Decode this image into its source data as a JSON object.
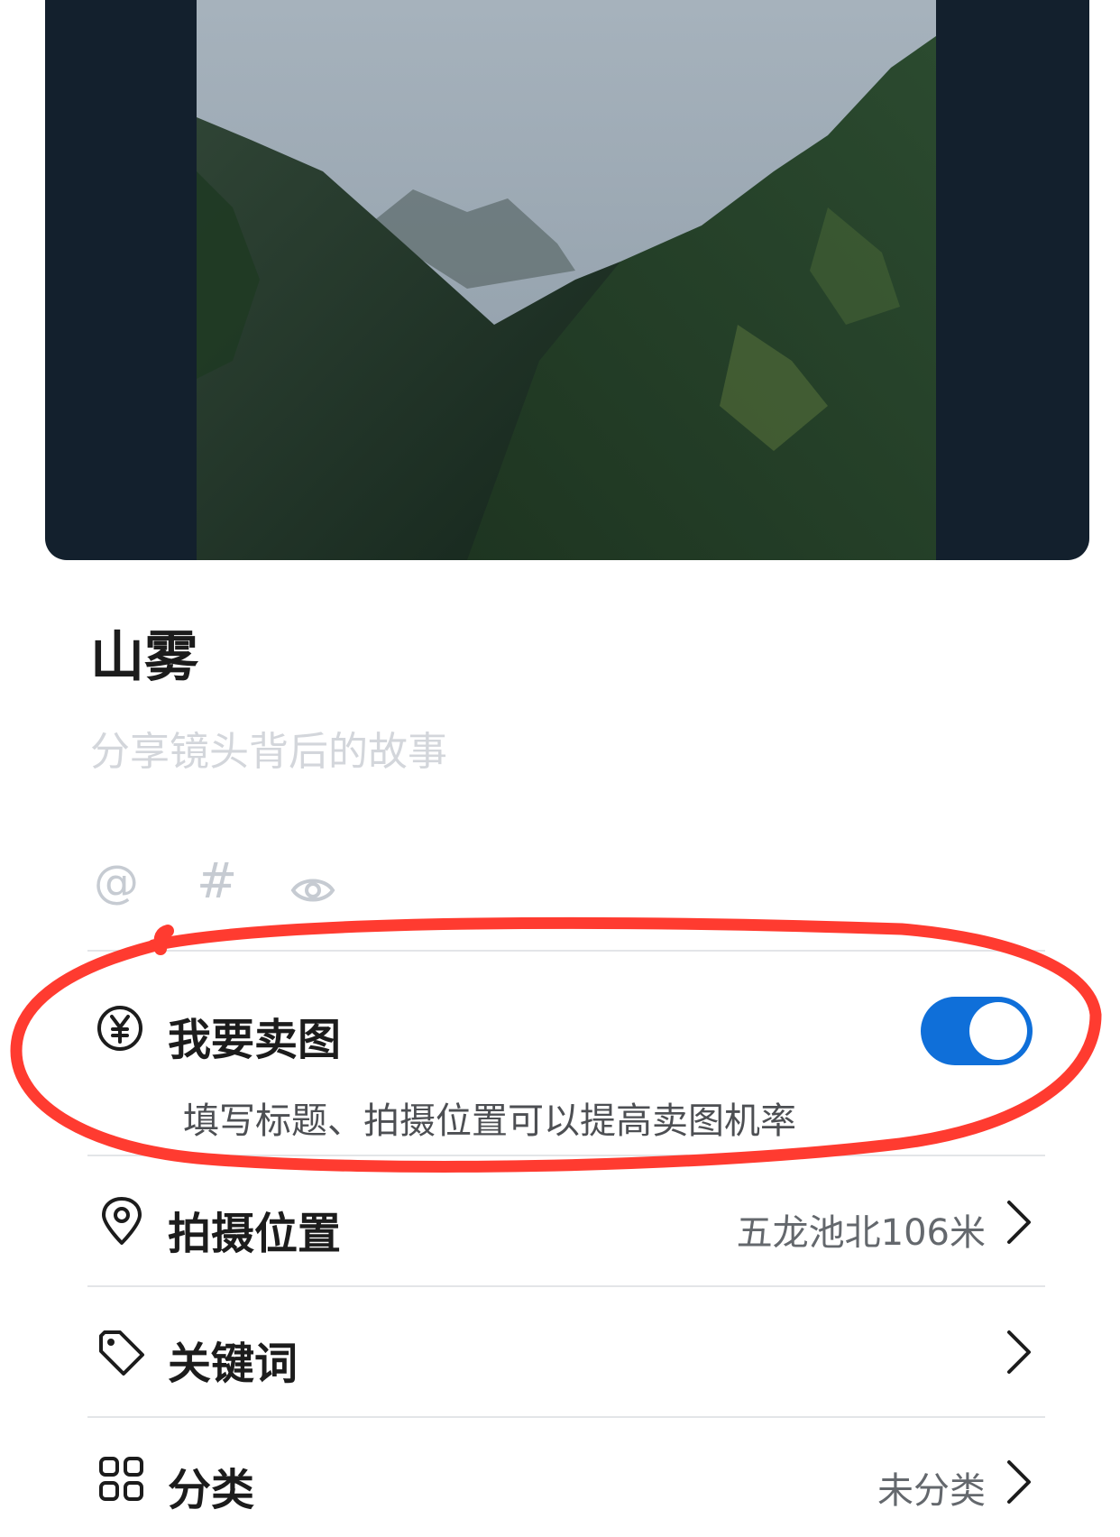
{
  "post": {
    "title": "山雾",
    "story_placeholder": "分享镜头背后的故事"
  },
  "toolbar": {
    "mention_symbol": "@",
    "topic_symbol": "#",
    "visibility_icon": "eye-icon"
  },
  "sell": {
    "label": "我要卖图",
    "icon": "yuan-circle-icon",
    "enabled": true,
    "hint": "填写标题、拍摄位置可以提高卖图机率"
  },
  "settings": [
    {
      "label": "拍摄位置",
      "icon": "location-pin-icon",
      "value": "五龙池北106米"
    },
    {
      "label": "关键词",
      "icon": "tag-icon",
      "value": ""
    },
    {
      "label": "分类",
      "icon": "grid-icon",
      "value": "未分类"
    }
  ],
  "colors": {
    "toggle_on": "#0f6fd9",
    "annotation": "#ff3b30",
    "photo_background": "#13202d"
  }
}
